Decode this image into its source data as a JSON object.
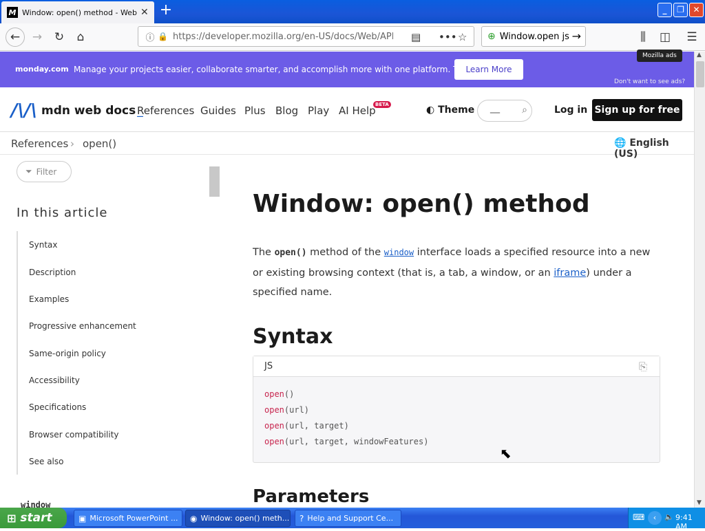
{
  "browser": {
    "tab_title": "Window: open() method - Web API",
    "tab_favicon": "M",
    "url": "https://developer.mozilla.org/en-US/docs/Web/API/W",
    "search_text": "Window.open js"
  },
  "ad": {
    "brand": "monday.com",
    "message": "Manage your projects easier, collaborate smarter, and accomplish more with one platform. Try it free.",
    "button": "Learn More",
    "tag": "Mozilla ads",
    "dismiss": "Don't want to see ads?"
  },
  "header": {
    "logo": "mdn web docs",
    "nav": [
      "References",
      "Guides",
      "Plus",
      "Blog",
      "Play",
      "AI Help"
    ],
    "beta": "BETA",
    "theme": "Theme",
    "search_value": "__",
    "login": "Log in",
    "signup": "Sign up for free"
  },
  "breadcrumb": {
    "items": [
      "References",
      "open()"
    ],
    "language": "English (US)"
  },
  "sidebar": {
    "filter": "Filter",
    "toc_heading": "In this article",
    "toc": [
      "Syntax",
      "Description",
      "Examples",
      "Progressive enhancement",
      "Same-origin policy",
      "Accessibility",
      "Specifications",
      "Browser compatibility",
      "See also"
    ],
    "related": "window"
  },
  "main": {
    "title": "Window: open() method",
    "intro_p1": "The ",
    "intro_code": "open()",
    "intro_p2": " method of the ",
    "intro_link1": "window",
    "intro_p3": " interface loads a specified resource into a new or existing browsing context (that is, a tab, a window, or an ",
    "intro_link2": "iframe",
    "intro_p4": ") under a specified name.",
    "syntax_heading": "Syntax",
    "code_lang": "JS",
    "code_lines": [
      {
        "fn": "open",
        "args": "()"
      },
      {
        "fn": "open",
        "args": "(url)"
      },
      {
        "fn": "open",
        "args": "(url, target)"
      },
      {
        "fn": "open",
        "args": "(url, target, windowFeatures)"
      }
    ],
    "params_heading": "Parameters"
  },
  "taskbar": {
    "start": "start",
    "tasks": [
      "Microsoft PowerPoint ...",
      "Window: open() meth...",
      "Help and Support Ce..."
    ],
    "clock": "9:41 AM"
  }
}
